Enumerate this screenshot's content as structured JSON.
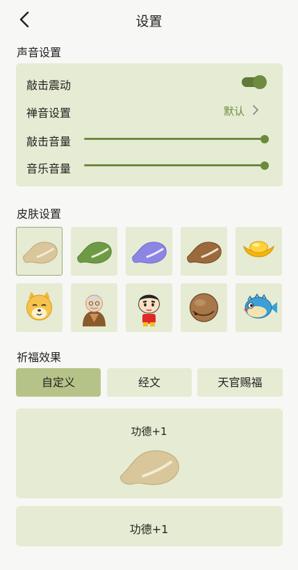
{
  "header": {
    "title": "设置"
  },
  "sound": {
    "title": "声音设置",
    "vibration_label": "敲击震动",
    "vibration_on": true,
    "zen_sound_label": "禅音设置",
    "zen_sound_value": "默认",
    "knock_volume_label": "敲击音量",
    "knock_volume": 1.0,
    "music_volume_label": "音乐音量",
    "music_volume": 1.0
  },
  "skin": {
    "title": "皮肤设置",
    "selected_index": 0,
    "items": [
      {
        "icon": "beige-woodenfish-icon"
      },
      {
        "icon": "green-woodenfish-icon"
      },
      {
        "icon": "purple-woodenfish-icon"
      },
      {
        "icon": "brown-woodenfish-icon"
      },
      {
        "icon": "gold-ingot-icon"
      },
      {
        "icon": "shiba-dog-icon"
      },
      {
        "icon": "old-monk-icon"
      },
      {
        "icon": "crayon-boy-icon"
      },
      {
        "icon": "round-woodenfish-icon"
      },
      {
        "icon": "pufferfish-icon"
      }
    ]
  },
  "blessing": {
    "title": "祈福效果",
    "tabs": [
      "自定义",
      "经文",
      "天官赐福"
    ],
    "active_tab": 0,
    "preview_text": "功德+1",
    "custom_text": "功德+1"
  },
  "colors": {
    "accent": "#6c8a3c",
    "card": "#e6ebd3",
    "active_tab": "#b6c388"
  }
}
